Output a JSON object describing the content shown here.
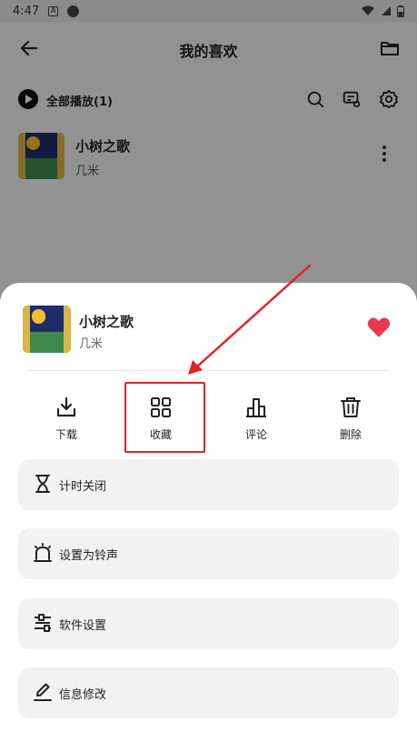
{
  "status_bar": {
    "time": "4:47",
    "notif_icon": "A"
  },
  "app_bar": {
    "title": "我的喜欢"
  },
  "play_all": {
    "label": "全部播放(1)"
  },
  "song": {
    "title": "小树之歌",
    "artist": "几米"
  },
  "sheet": {
    "song_title": "小树之歌",
    "song_artist": "几米",
    "favorite_color": "#e8384f",
    "actions": [
      {
        "label": "下载",
        "icon": "download-icon"
      },
      {
        "label": "收藏",
        "icon": "grid-icon"
      },
      {
        "label": "评论",
        "icon": "comment-chart-icon"
      },
      {
        "label": "删除",
        "icon": "trash-icon"
      }
    ],
    "menu": [
      {
        "label": "计时关闭",
        "icon": "hourglass-icon"
      },
      {
        "label": "设置为铃声",
        "icon": "alarm-bell-icon"
      },
      {
        "label": "软件设置",
        "icon": "settings-sliders-icon"
      },
      {
        "label": "信息修改",
        "icon": "edit-pen-icon"
      }
    ]
  },
  "annotation": {
    "highlight_color": "#e02424"
  }
}
